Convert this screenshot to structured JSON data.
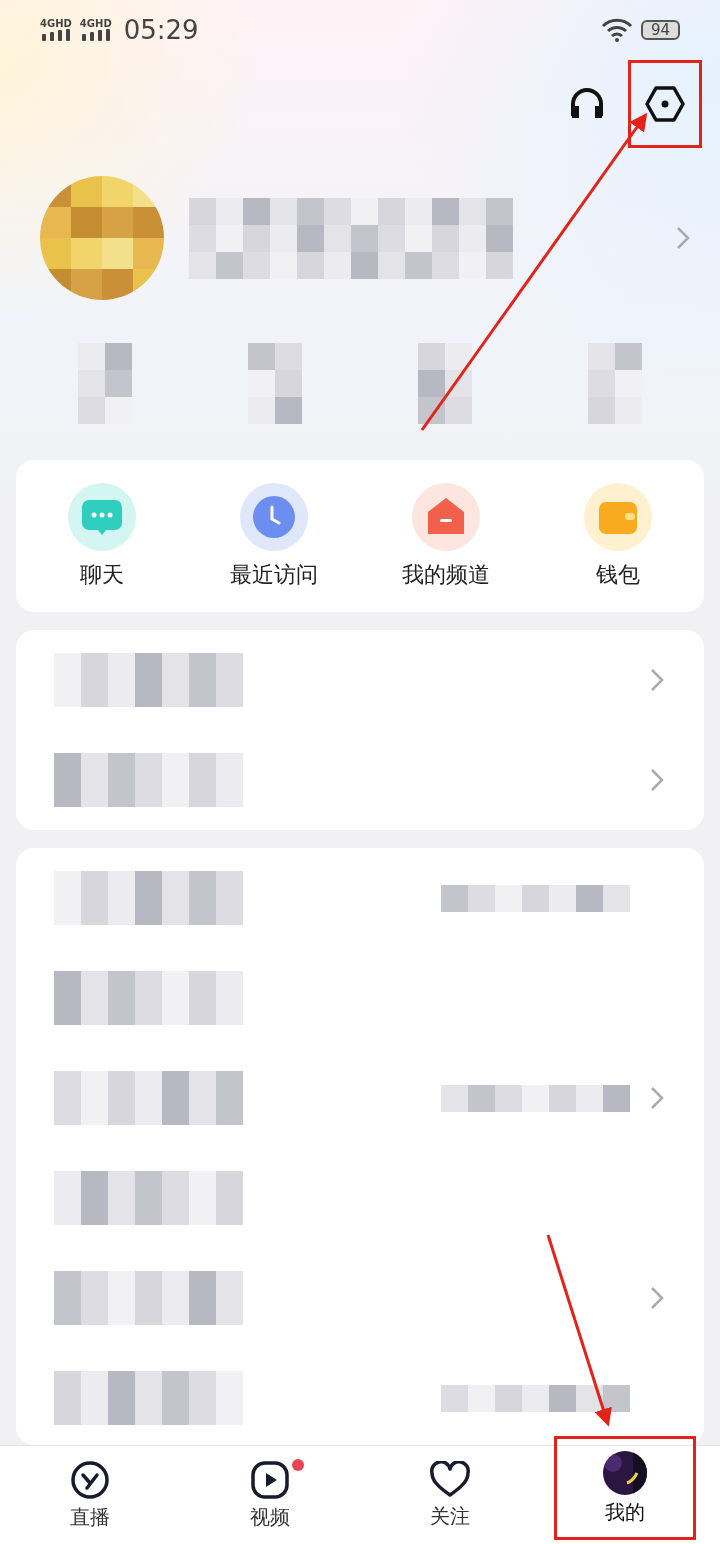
{
  "status_bar": {
    "signal_labels": [
      "4GHD",
      "4GHD"
    ],
    "time": "05:29",
    "battery": "94"
  },
  "header": {
    "actions": [
      {
        "kind": "headphones",
        "highlighted": false
      },
      {
        "kind": "settings",
        "highlighted": true
      }
    ]
  },
  "profile": {
    "redacted": true,
    "chevron": true
  },
  "stats": [
    {
      "kind": "redacted"
    },
    {
      "kind": "redacted"
    },
    {
      "kind": "redacted"
    },
    {
      "kind": "redacted"
    }
  ],
  "quick_actions": [
    {
      "kind": "chat",
      "label": "聊天"
    },
    {
      "kind": "clock",
      "label": "最近访问"
    },
    {
      "kind": "house",
      "label": "我的频道"
    },
    {
      "kind": "wallet",
      "label": "钱包"
    }
  ],
  "menu_groups": [
    {
      "rows": [
        {
          "detail": false,
          "chevron": true
        },
        {
          "detail": false,
          "chevron": true
        }
      ]
    },
    {
      "rows": [
        {
          "detail": true,
          "chevron": false
        },
        {
          "detail": false,
          "chevron": false
        },
        {
          "detail": true,
          "chevron": true
        },
        {
          "detail": false,
          "chevron": false
        },
        {
          "detail": false,
          "chevron": true
        },
        {
          "detail": true,
          "chevron": false
        }
      ]
    }
  ],
  "tabs": [
    {
      "kind": "live",
      "label": "直播",
      "selected": false,
      "badge": false,
      "highlighted": false
    },
    {
      "kind": "video",
      "label": "视频",
      "selected": false,
      "badge": true,
      "highlighted": false
    },
    {
      "kind": "follow",
      "label": "关注",
      "selected": false,
      "badge": false,
      "highlighted": false
    },
    {
      "kind": "profile",
      "label": "我的",
      "selected": true,
      "badge": false,
      "highlighted": true
    }
  ]
}
